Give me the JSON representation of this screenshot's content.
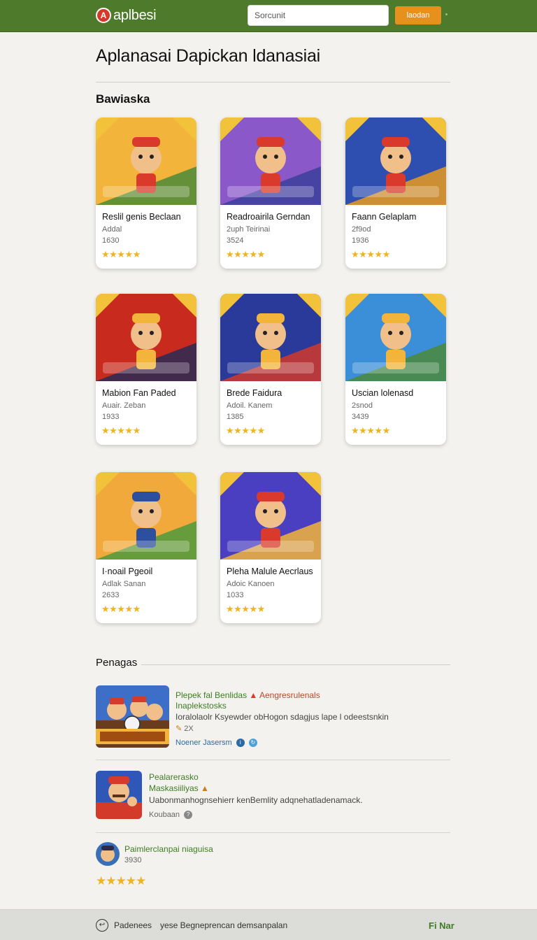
{
  "header": {
    "logo_text": "aplbesi",
    "search_placeholder": "Sorcunit",
    "search_button": "laodan"
  },
  "page_title": "Aplanasai Dapickan ldanasiai",
  "section_title": "Bawiaska",
  "cards": [
    {
      "name": "Reslil genis Beclaan",
      "developer": "Addal",
      "count": "1630",
      "stars": "★★★★★",
      "palette": [
        "#f2b43a",
        "#4b8a3a",
        "#d93a2b"
      ]
    },
    {
      "name": "Readroairila Gerndan",
      "developer": "2uph Teirinai",
      "count": "3524",
      "stars": "★★★★★",
      "palette": [
        "#8a58c8",
        "#3a3f9b",
        "#d93a2b"
      ]
    },
    {
      "name": "Faann Gelaplam",
      "developer": "2f9od",
      "count": "1936",
      "stars": "★★★★★",
      "palette": [
        "#2f4fb0",
        "#e89a1e",
        "#d93a2b"
      ]
    },
    {
      "name": "Mabion Fan Paded",
      "developer": "Auair. Zeban",
      "count": "1933",
      "stars": "★★★★★",
      "palette": [
        "#c92a1e",
        "#2a2a55",
        "#f2b43a"
      ]
    },
    {
      "name": "Brede Faidura",
      "developer": "Adoil. Kanem",
      "count": "1385",
      "stars": "★★★★★",
      "palette": [
        "#2a3a9a",
        "#d03a2a",
        "#f2b43a"
      ]
    },
    {
      "name": "Uscian lolenasd",
      "developer": "2snod",
      "count": "3439",
      "stars": "★★★★★",
      "palette": [
        "#3b8fd8",
        "#4b8a3a",
        "#f2b43a"
      ]
    },
    {
      "name": "I·noail Pgeoil",
      "developer": "Adlak Sanan",
      "count": "2633",
      "stars": "★★★★★",
      "palette": [
        "#f0a93a",
        "#4f9a3e",
        "#2c4fa0"
      ]
    },
    {
      "name": "Pleha Malule Aecrlaus",
      "developer": "Adoic Kanoen",
      "count": "1033",
      "stars": "★★★★★",
      "palette": [
        "#4a3fc0",
        "#f2b43a",
        "#d93a2b"
      ]
    }
  ],
  "reviews_section": "Penagas",
  "reviews": [
    {
      "title_1": "Plepek fal Benlidas",
      "title_2": "Aengresrulenals",
      "title_3": "Inaplekstosks",
      "text": "Ioralolaolr Ksyewder obHogon sdagjus lape l odeestsnkin",
      "count": "2X",
      "link": "Noener Jasersm"
    },
    {
      "title_1": "Pealarerasko",
      "title_2": "Maskasiiliyas",
      "text": "Uabonmanhognsehierr kenBemlity adqnehatladenamack.",
      "meta": "Koubaan"
    },
    {
      "title_1": "Paimlerclanpai niaguisa",
      "count": "3930",
      "stars": "★★★★★"
    }
  ],
  "footer": {
    "item_1": "Padenees",
    "item_2": "yese Begneprencan demsanpalan",
    "item_3": "Fi Nar"
  },
  "colors": {
    "header_bg": "#4e7a2c",
    "accent_button": "#e6901e",
    "star": "#f0b323",
    "review_title": "#3e7d23"
  }
}
